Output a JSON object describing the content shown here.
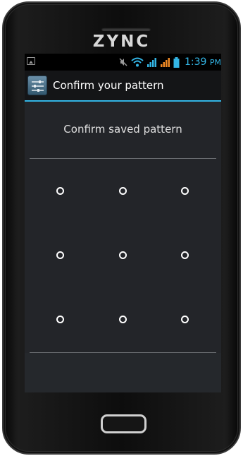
{
  "device": {
    "brand": "ZYNC"
  },
  "status_bar": {
    "time": "1:39",
    "ampm": "PM",
    "accent_color": "#33b5e5",
    "icons": [
      "image-notification-icon",
      "mute-icon",
      "wifi-icon",
      "signal-icon",
      "signal-icon",
      "battery-icon"
    ]
  },
  "title_bar": {
    "title": "Confirm your pattern"
  },
  "content": {
    "header_text": "Confirm saved pattern",
    "pattern_dots": [
      {
        "id": 1
      },
      {
        "id": 2
      },
      {
        "id": 3
      },
      {
        "id": 4
      },
      {
        "id": 5
      },
      {
        "id": 6
      },
      {
        "id": 7
      },
      {
        "id": 8
      },
      {
        "id": 9
      }
    ]
  }
}
